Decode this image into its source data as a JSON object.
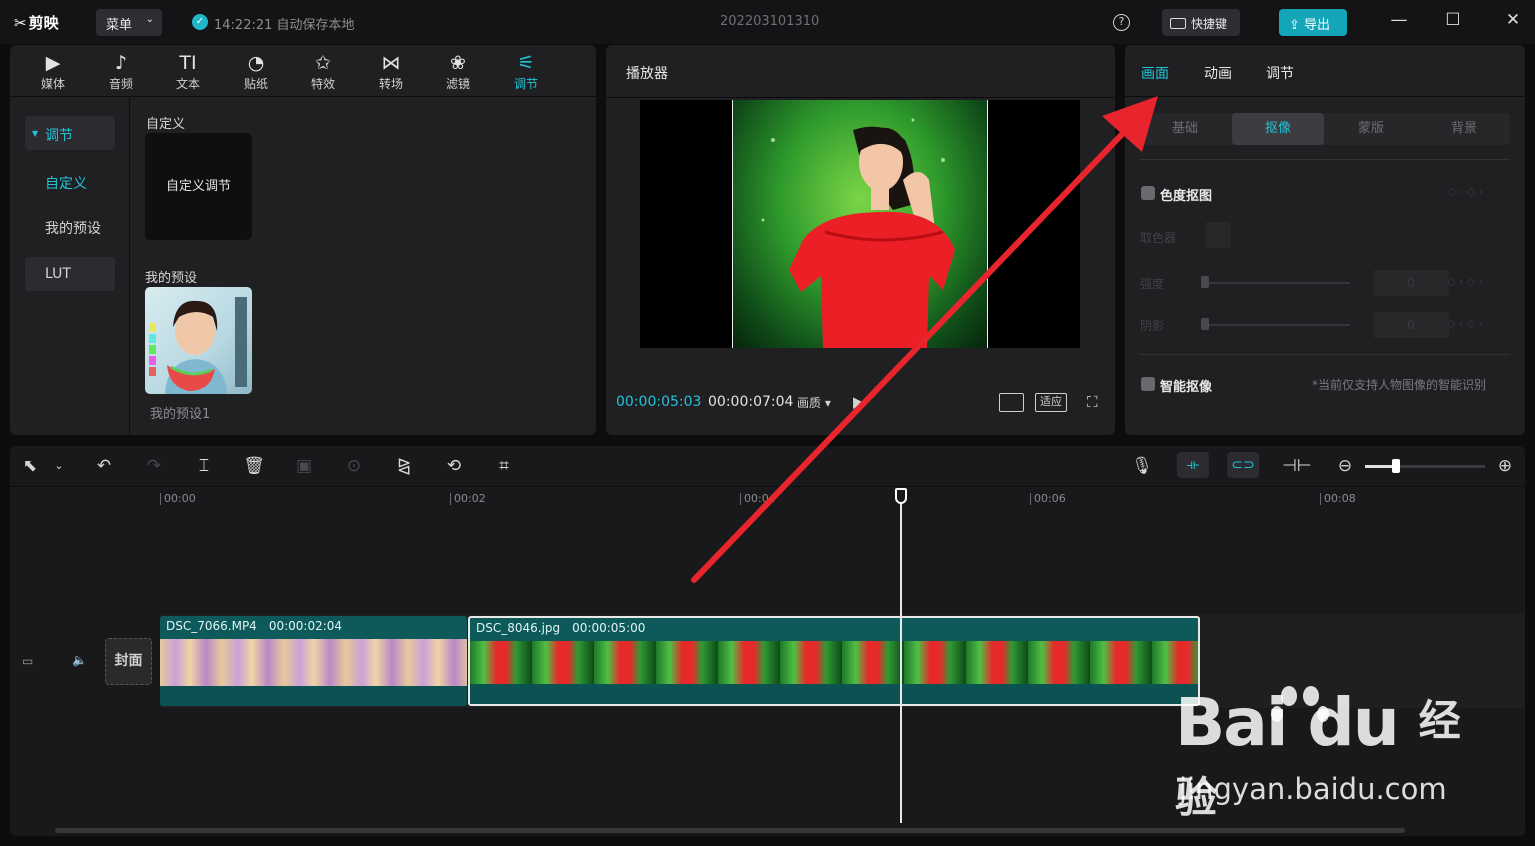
{
  "titlebar": {
    "app_name": "剪映",
    "menu_label": "菜单",
    "save_status": "14:22:21 自动保存本地",
    "project_name": "202203101310",
    "shortcut_label": "快捷键",
    "export_label": "导出"
  },
  "tool_tabs": [
    {
      "label": "媒体",
      "icon": "media-icon"
    },
    {
      "label": "音频",
      "icon": "audio-icon"
    },
    {
      "label": "文本",
      "icon": "text-icon"
    },
    {
      "label": "贴纸",
      "icon": "sticker-icon"
    },
    {
      "label": "特效",
      "icon": "effects-icon"
    },
    {
      "label": "转场",
      "icon": "transition-icon"
    },
    {
      "label": "滤镜",
      "icon": "filter-icon"
    },
    {
      "label": "调节",
      "icon": "adjust-icon",
      "active": true
    }
  ],
  "sidebar": {
    "items": [
      {
        "label": "调节"
      },
      {
        "label": "自定义"
      },
      {
        "label": "我的预设"
      },
      {
        "label": "LUT"
      }
    ]
  },
  "media_content": {
    "custom_section": "自定义",
    "custom_card": "自定义调节",
    "preset_section": "我的预设",
    "preset_name": "我的预设1"
  },
  "player": {
    "title": "播放器",
    "current_time": "00:00:05:03",
    "total_time": "00:00:07:04",
    "quality": "画质",
    "fit_label": "适应"
  },
  "props": {
    "tabs": [
      "画面",
      "动画",
      "调节"
    ],
    "sub_tabs": [
      "基础",
      "抠像",
      "蒙版",
      "背景"
    ],
    "chroma_key_label": "色度抠图",
    "color_picker_label": "取色器",
    "strength_label": "强度",
    "shadow_label": "阴影",
    "strength_value": "0",
    "shadow_value": "0",
    "smart_cutout_label": "智能抠像",
    "smart_cutout_hint": "*当前仅支持人物图像的智能识别"
  },
  "timeline": {
    "ruler": [
      "00:00",
      "00:02",
      "00:04",
      "00:06",
      "00:08"
    ],
    "cover_label": "封面",
    "clips": [
      {
        "name": "DSC_7066.MP4",
        "duration": "00:00:02:04"
      },
      {
        "name": "DSC_8046.jpg",
        "duration": "00:00:05:00"
      }
    ]
  },
  "watermark": {
    "brand": "Bai du",
    "suffix": "经验",
    "url": "jingyan.baidu.com"
  },
  "colors": {
    "accent": "#20c4d8",
    "export": "#14a6b8",
    "annotation_arrow": "#e8242c"
  }
}
